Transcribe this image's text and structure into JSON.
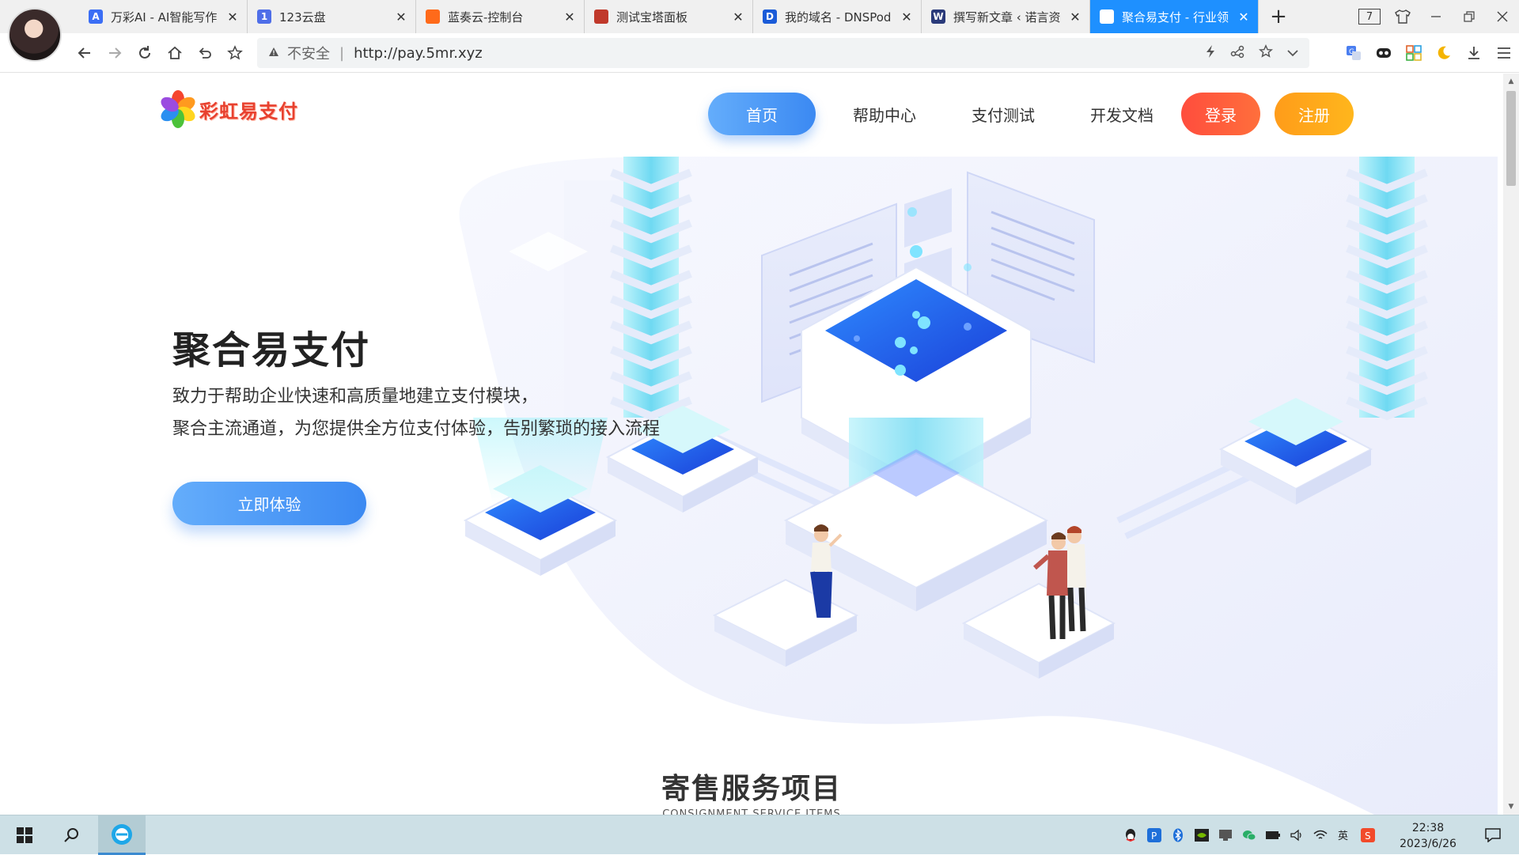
{
  "browser": {
    "tabs": [
      {
        "label": "万彩AI - AI智能写作",
        "icon": "wancai-ai-icon",
        "color": "#3b6ef5"
      },
      {
        "label": "123云盘",
        "icon": "123pan-icon",
        "color": "#4f6ee8"
      },
      {
        "label": "蓝奏云-控制台",
        "icon": "lanzou-icon",
        "color": "#ff6a1a"
      },
      {
        "label": "测试宝塔面板",
        "icon": "baota-icon",
        "color": "#c0392b"
      },
      {
        "label": "我的域名 - DNSPod",
        "icon": "dnspod-icon",
        "color": "#1a5bd8"
      },
      {
        "label": "撰写新文章 ‹ 诺言资",
        "icon": "wordpress-icon",
        "color": "#2a3a7a"
      },
      {
        "label": "聚合易支付 - 行业领",
        "icon": "page-icon",
        "color": "#1e90ff"
      }
    ],
    "active_tab_index": 6,
    "tab_count": "7",
    "address": {
      "security_label": "不安全",
      "url": "http://pay.5mr.xyz"
    }
  },
  "site": {
    "logo_text": "彩虹易支付",
    "nav": {
      "home": "首页",
      "help": "帮助中心",
      "pay_test": "支付测试",
      "docs": "开发文档",
      "login": "登录",
      "register": "注册"
    },
    "hero": {
      "title": "聚合易支付",
      "line1": "致力于帮助企业快速和高质量地建立支付模块，",
      "line2": "聚合主流通道，为您提供全方位支付体验，告别繁琐的接入流程",
      "cta": "立即体验"
    },
    "section": {
      "title": "寄售服务项目",
      "subtitle": "CONSIGNMENT SERVICE ITEMS"
    }
  },
  "taskbar": {
    "time": "22:38",
    "date": "2023/6/26"
  },
  "colors": {
    "brand_blue": "#3b89f2",
    "login_red": "#ff5a3c",
    "register_orange": "#ffa81b",
    "active_tab": "#1e90ff"
  }
}
